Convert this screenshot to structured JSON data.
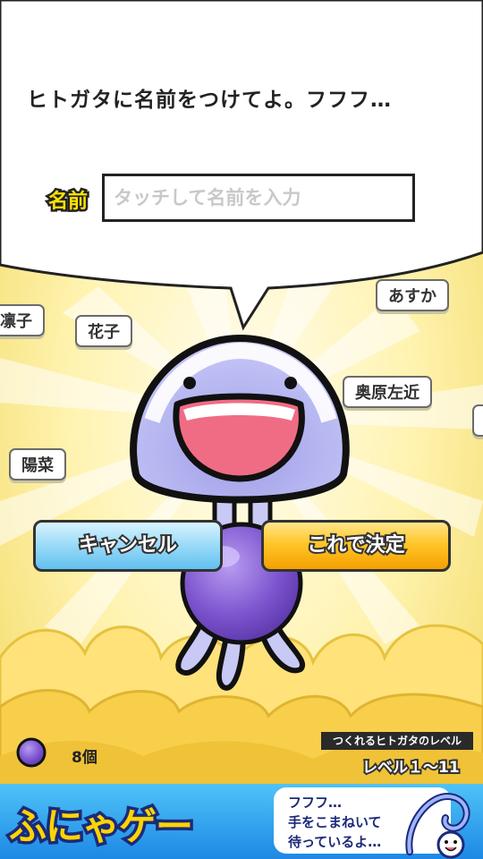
{
  "dialog": {
    "message": "ヒトガタに名前をつけてよ。フフフ…",
    "name_label": "名前",
    "name_value": "",
    "name_placeholder": "タッチして名前を入力"
  },
  "suggested_names": [
    {
      "name": "凛子"
    },
    {
      "name": "花子"
    },
    {
      "name": "あすか"
    },
    {
      "name": "奥原左近"
    },
    {
      "name": "陽菜"
    },
    {
      "name": ""
    }
  ],
  "buttons": {
    "cancel": "キャンセル",
    "confirm": "これで決定"
  },
  "status": {
    "orb_count": "8個",
    "level_title": "つくれるヒトガタのレベル",
    "level_range": "レベル１～11"
  },
  "ad": {
    "logo": "ふにゃゲー",
    "line1": "フフフ…",
    "line2": "手をこまねいて",
    "line3": "待っているよ…"
  },
  "colors": {
    "creature_body": "#b8b8f2",
    "orb": "#8a64d8",
    "cancel_button": "#7fd0f5",
    "confirm_button": "#ffb800",
    "name_label": "#ffe400",
    "background_glow": "#fff5c0"
  }
}
